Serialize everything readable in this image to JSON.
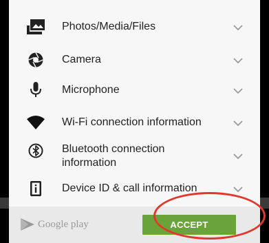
{
  "permissions": [
    {
      "icon": "photo-icon",
      "label": "Photos/Media/Files"
    },
    {
      "icon": "camera-icon",
      "label": "Camera"
    },
    {
      "icon": "microphone-icon",
      "label": "Microphone"
    },
    {
      "icon": "wifi-icon",
      "label": "Wi-Fi connection information"
    },
    {
      "icon": "bluetooth-icon",
      "label": "Bluetooth connection information"
    },
    {
      "icon": "device-id-icon",
      "label": "Device ID & call information"
    }
  ],
  "footer": {
    "store_name": "Google play",
    "accept_label": "ACCEPT"
  },
  "colors": {
    "accept_button": "#6aa339",
    "highlight_ring": "#e0392c"
  }
}
